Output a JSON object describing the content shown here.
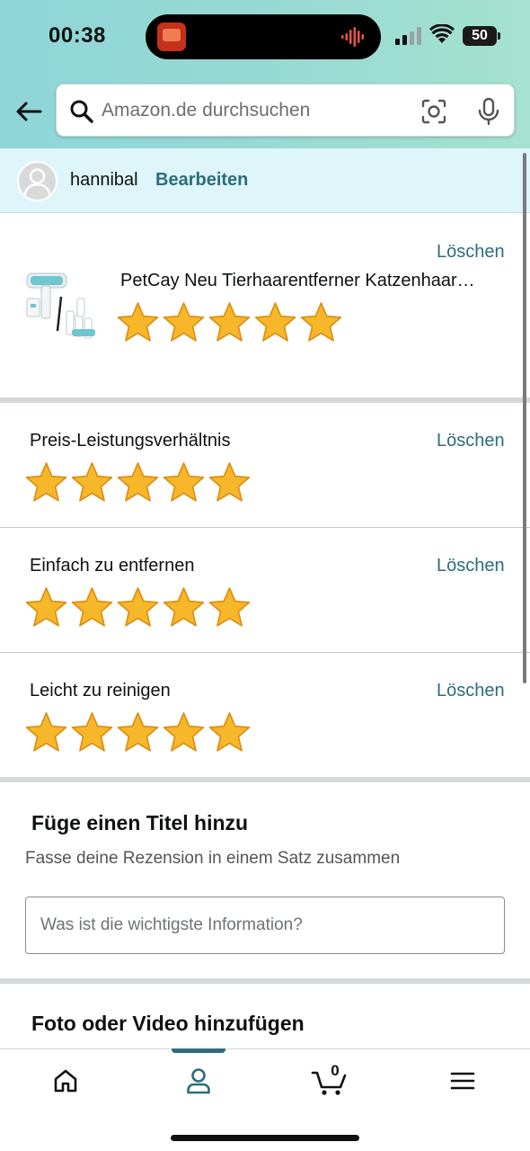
{
  "status_bar": {
    "time": "00:38",
    "battery": "50"
  },
  "search": {
    "placeholder": "Amazon.de durchsuchen"
  },
  "user": {
    "name": "hannibal",
    "edit_label": "Bearbeiten"
  },
  "product": {
    "title": "PetCay Neu Tierhaarentferner Katzenhaarentferner",
    "delete_label": "Löschen",
    "rating": 5,
    "rating_max": 5
  },
  "ratings": [
    {
      "label": "Preis-Leistungsverhältnis",
      "delete_label": "Löschen",
      "rating": 5
    },
    {
      "label": "Einfach zu entfernen",
      "delete_label": "Löschen",
      "rating": 5
    },
    {
      "label": "Leicht zu reinigen",
      "delete_label": "Löschen",
      "rating": 5
    }
  ],
  "title_section": {
    "heading": "Füge einen Titel hinzu",
    "hint": "Fasse deine Rezension in einem Satz zusammen",
    "input_placeholder": "Was ist die wichtigste Information?"
  },
  "photo_section": {
    "heading": "Foto oder Video hinzufügen"
  },
  "bottom_nav": {
    "cart_count": "0",
    "items": [
      "home-icon",
      "account-icon",
      "cart-icon",
      "menu-icon"
    ],
    "active": "account-icon"
  },
  "colors": {
    "accent": "#2c6c7e",
    "star_fill": "#f6b72a",
    "star_stroke": "#de8c0e",
    "user_bar_bg": "#def5fa"
  }
}
